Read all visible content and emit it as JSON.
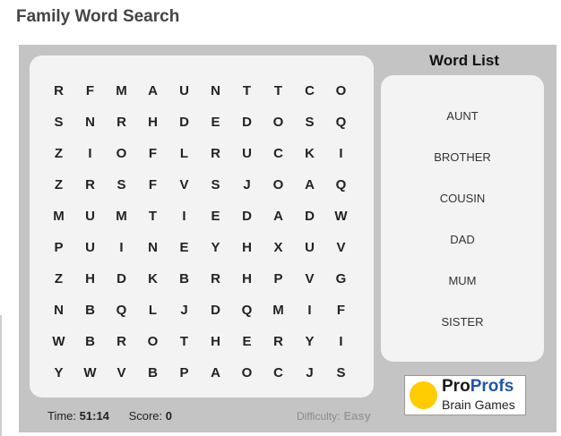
{
  "title": "Family Word Search",
  "grid": [
    [
      "R",
      "F",
      "M",
      "A",
      "U",
      "N",
      "T",
      "T",
      "C",
      "O"
    ],
    [
      "S",
      "N",
      "R",
      "H",
      "D",
      "E",
      "D",
      "O",
      "S",
      "Q"
    ],
    [
      "Z",
      "I",
      "O",
      "F",
      "L",
      "R",
      "U",
      "C",
      "K",
      "I"
    ],
    [
      "Z",
      "R",
      "S",
      "F",
      "V",
      "S",
      "J",
      "O",
      "A",
      "Q"
    ],
    [
      "M",
      "U",
      "M",
      "T",
      "I",
      "E",
      "D",
      "A",
      "D",
      "W"
    ],
    [
      "P",
      "U",
      "I",
      "N",
      "E",
      "Y",
      "H",
      "X",
      "U",
      "V"
    ],
    [
      "Z",
      "H",
      "D",
      "K",
      "B",
      "R",
      "H",
      "P",
      "V",
      "G"
    ],
    [
      "N",
      "B",
      "Q",
      "L",
      "J",
      "D",
      "Q",
      "M",
      "I",
      "F"
    ],
    [
      "W",
      "B",
      "R",
      "O",
      "T",
      "H",
      "E",
      "R",
      "Y",
      "I"
    ],
    [
      "Y",
      "W",
      "V",
      "B",
      "P",
      "A",
      "O",
      "C",
      "J",
      "S"
    ]
  ],
  "word_list": {
    "title": "Word List",
    "words": [
      "AUNT",
      "BROTHER",
      "COUSIN",
      "DAD",
      "MUM",
      "SISTER"
    ]
  },
  "status": {
    "time_label": "Time:",
    "time_value": "51:14",
    "score_label": "Score:",
    "score_value": "0",
    "difficulty_label": "Difficulty:",
    "difficulty_value": "Easy"
  },
  "logo": {
    "part1": "Pro",
    "part2": "Profs",
    "line2": "Brain Games"
  },
  "colors": {
    "background": "#c4c4c4",
    "panel": "#f3f3f3",
    "logo_circle": "#ffcc00"
  }
}
